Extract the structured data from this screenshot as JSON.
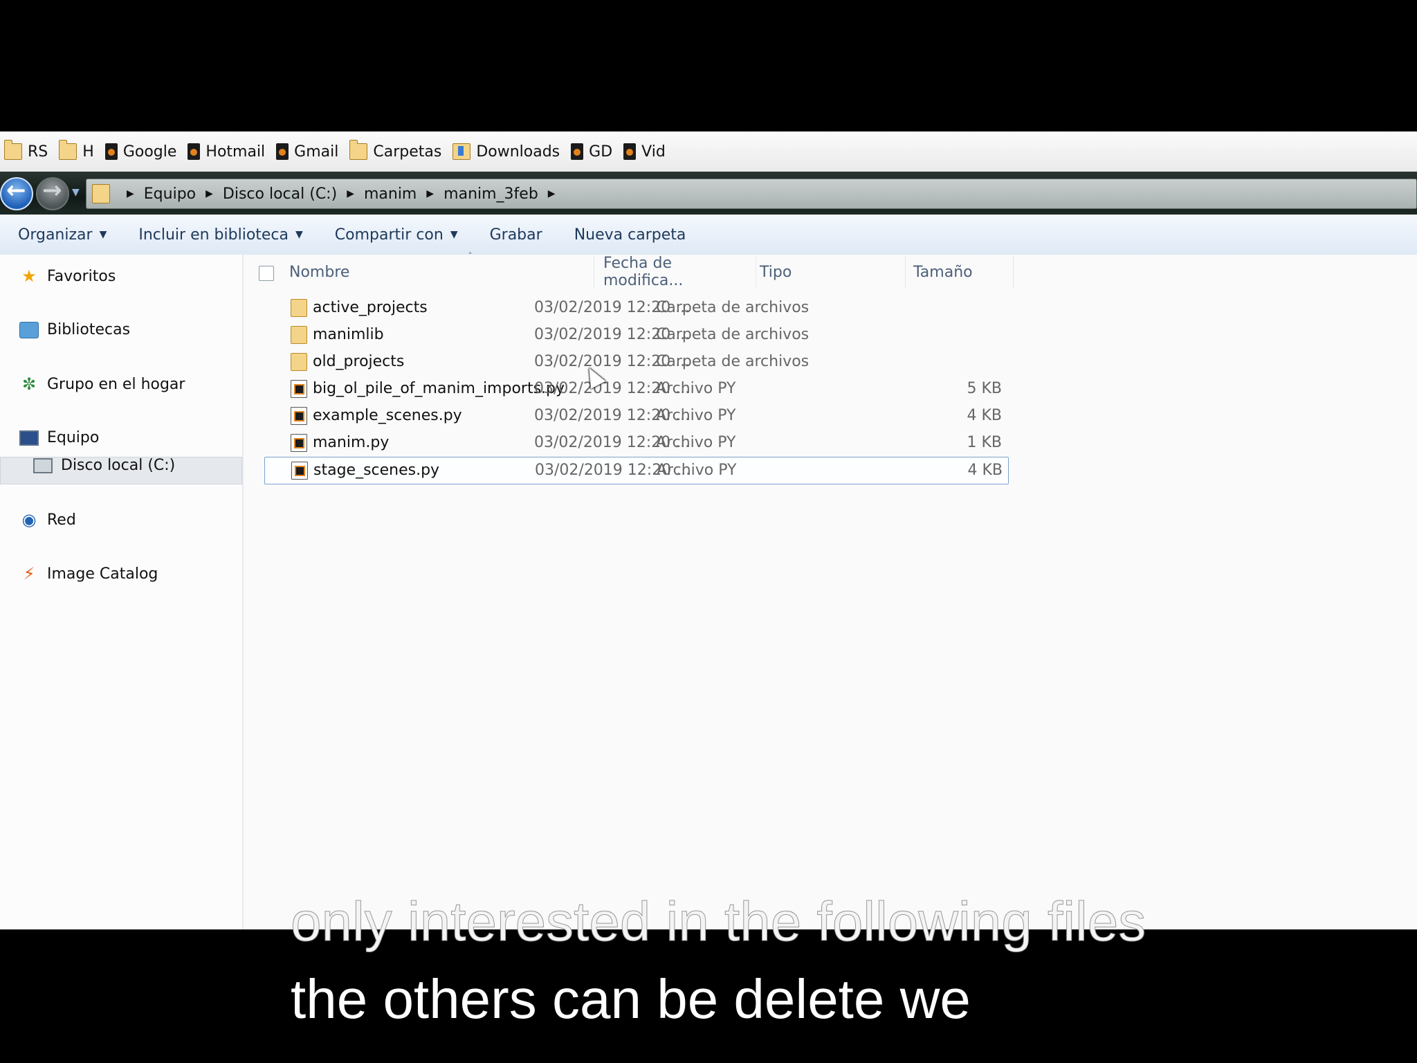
{
  "bookmarks": [
    {
      "label": "RS",
      "icon": "folder-icon"
    },
    {
      "label": "H",
      "icon": "folder-icon"
    },
    {
      "label": "Google",
      "icon": "page-icon"
    },
    {
      "label": "Hotmail",
      "icon": "page-icon"
    },
    {
      "label": "Gmail",
      "icon": "page-icon"
    },
    {
      "label": "Carpetas",
      "icon": "folder-icon"
    },
    {
      "label": "Downloads",
      "icon": "downloads-folder-icon"
    },
    {
      "label": "GD",
      "icon": "page-icon"
    },
    {
      "label": "Vid",
      "icon": "page-icon"
    }
  ],
  "breadcrumb": [
    "Equipo",
    "Disco local (C:)",
    "manim",
    "manim_3feb"
  ],
  "toolbar": {
    "organize": "Organizar",
    "include": "Incluir en biblioteca",
    "share": "Compartir con",
    "burn": "Grabar",
    "new_folder": "Nueva carpeta"
  },
  "nav": {
    "favorites": "Favoritos",
    "libraries": "Bibliotecas",
    "homegroup": "Grupo en el hogar",
    "computer": "Equipo",
    "local_disk": "Disco local (C:)",
    "network": "Red",
    "image_catalog": "Image Catalog"
  },
  "columns": {
    "name": "Nombre",
    "date": "Fecha de modifica...",
    "type": "Tipo",
    "size": "Tamaño"
  },
  "files": [
    {
      "name": "active_projects",
      "date": "03/02/2019 12:20 ...",
      "type": "Carpeta de archivos",
      "size": "",
      "kind": "folder"
    },
    {
      "name": "manimlib",
      "date": "03/02/2019 12:20 ...",
      "type": "Carpeta de archivos",
      "size": "",
      "kind": "folder"
    },
    {
      "name": "old_projects",
      "date": "03/02/2019 12:20 ...",
      "type": "Carpeta de archivos",
      "size": "",
      "kind": "folder"
    },
    {
      "name": "big_ol_pile_of_manim_imports.py",
      "date": "03/02/2019 12:20 ...",
      "type": "Archivo PY",
      "size": "5 KB",
      "kind": "py"
    },
    {
      "name": "example_scenes.py",
      "date": "03/02/2019 12:20 ...",
      "type": "Archivo PY",
      "size": "4 KB",
      "kind": "py"
    },
    {
      "name": "manim.py",
      "date": "03/02/2019 12:20 ...",
      "type": "Archivo PY",
      "size": "1 KB",
      "kind": "py"
    },
    {
      "name": "stage_scenes.py",
      "date": "03/02/2019 12:20 ...",
      "type": "Archivo PY",
      "size": "4 KB",
      "kind": "py"
    }
  ],
  "subtitles": {
    "line1": "only interested in the following files",
    "line2": "the others can be delete we"
  }
}
